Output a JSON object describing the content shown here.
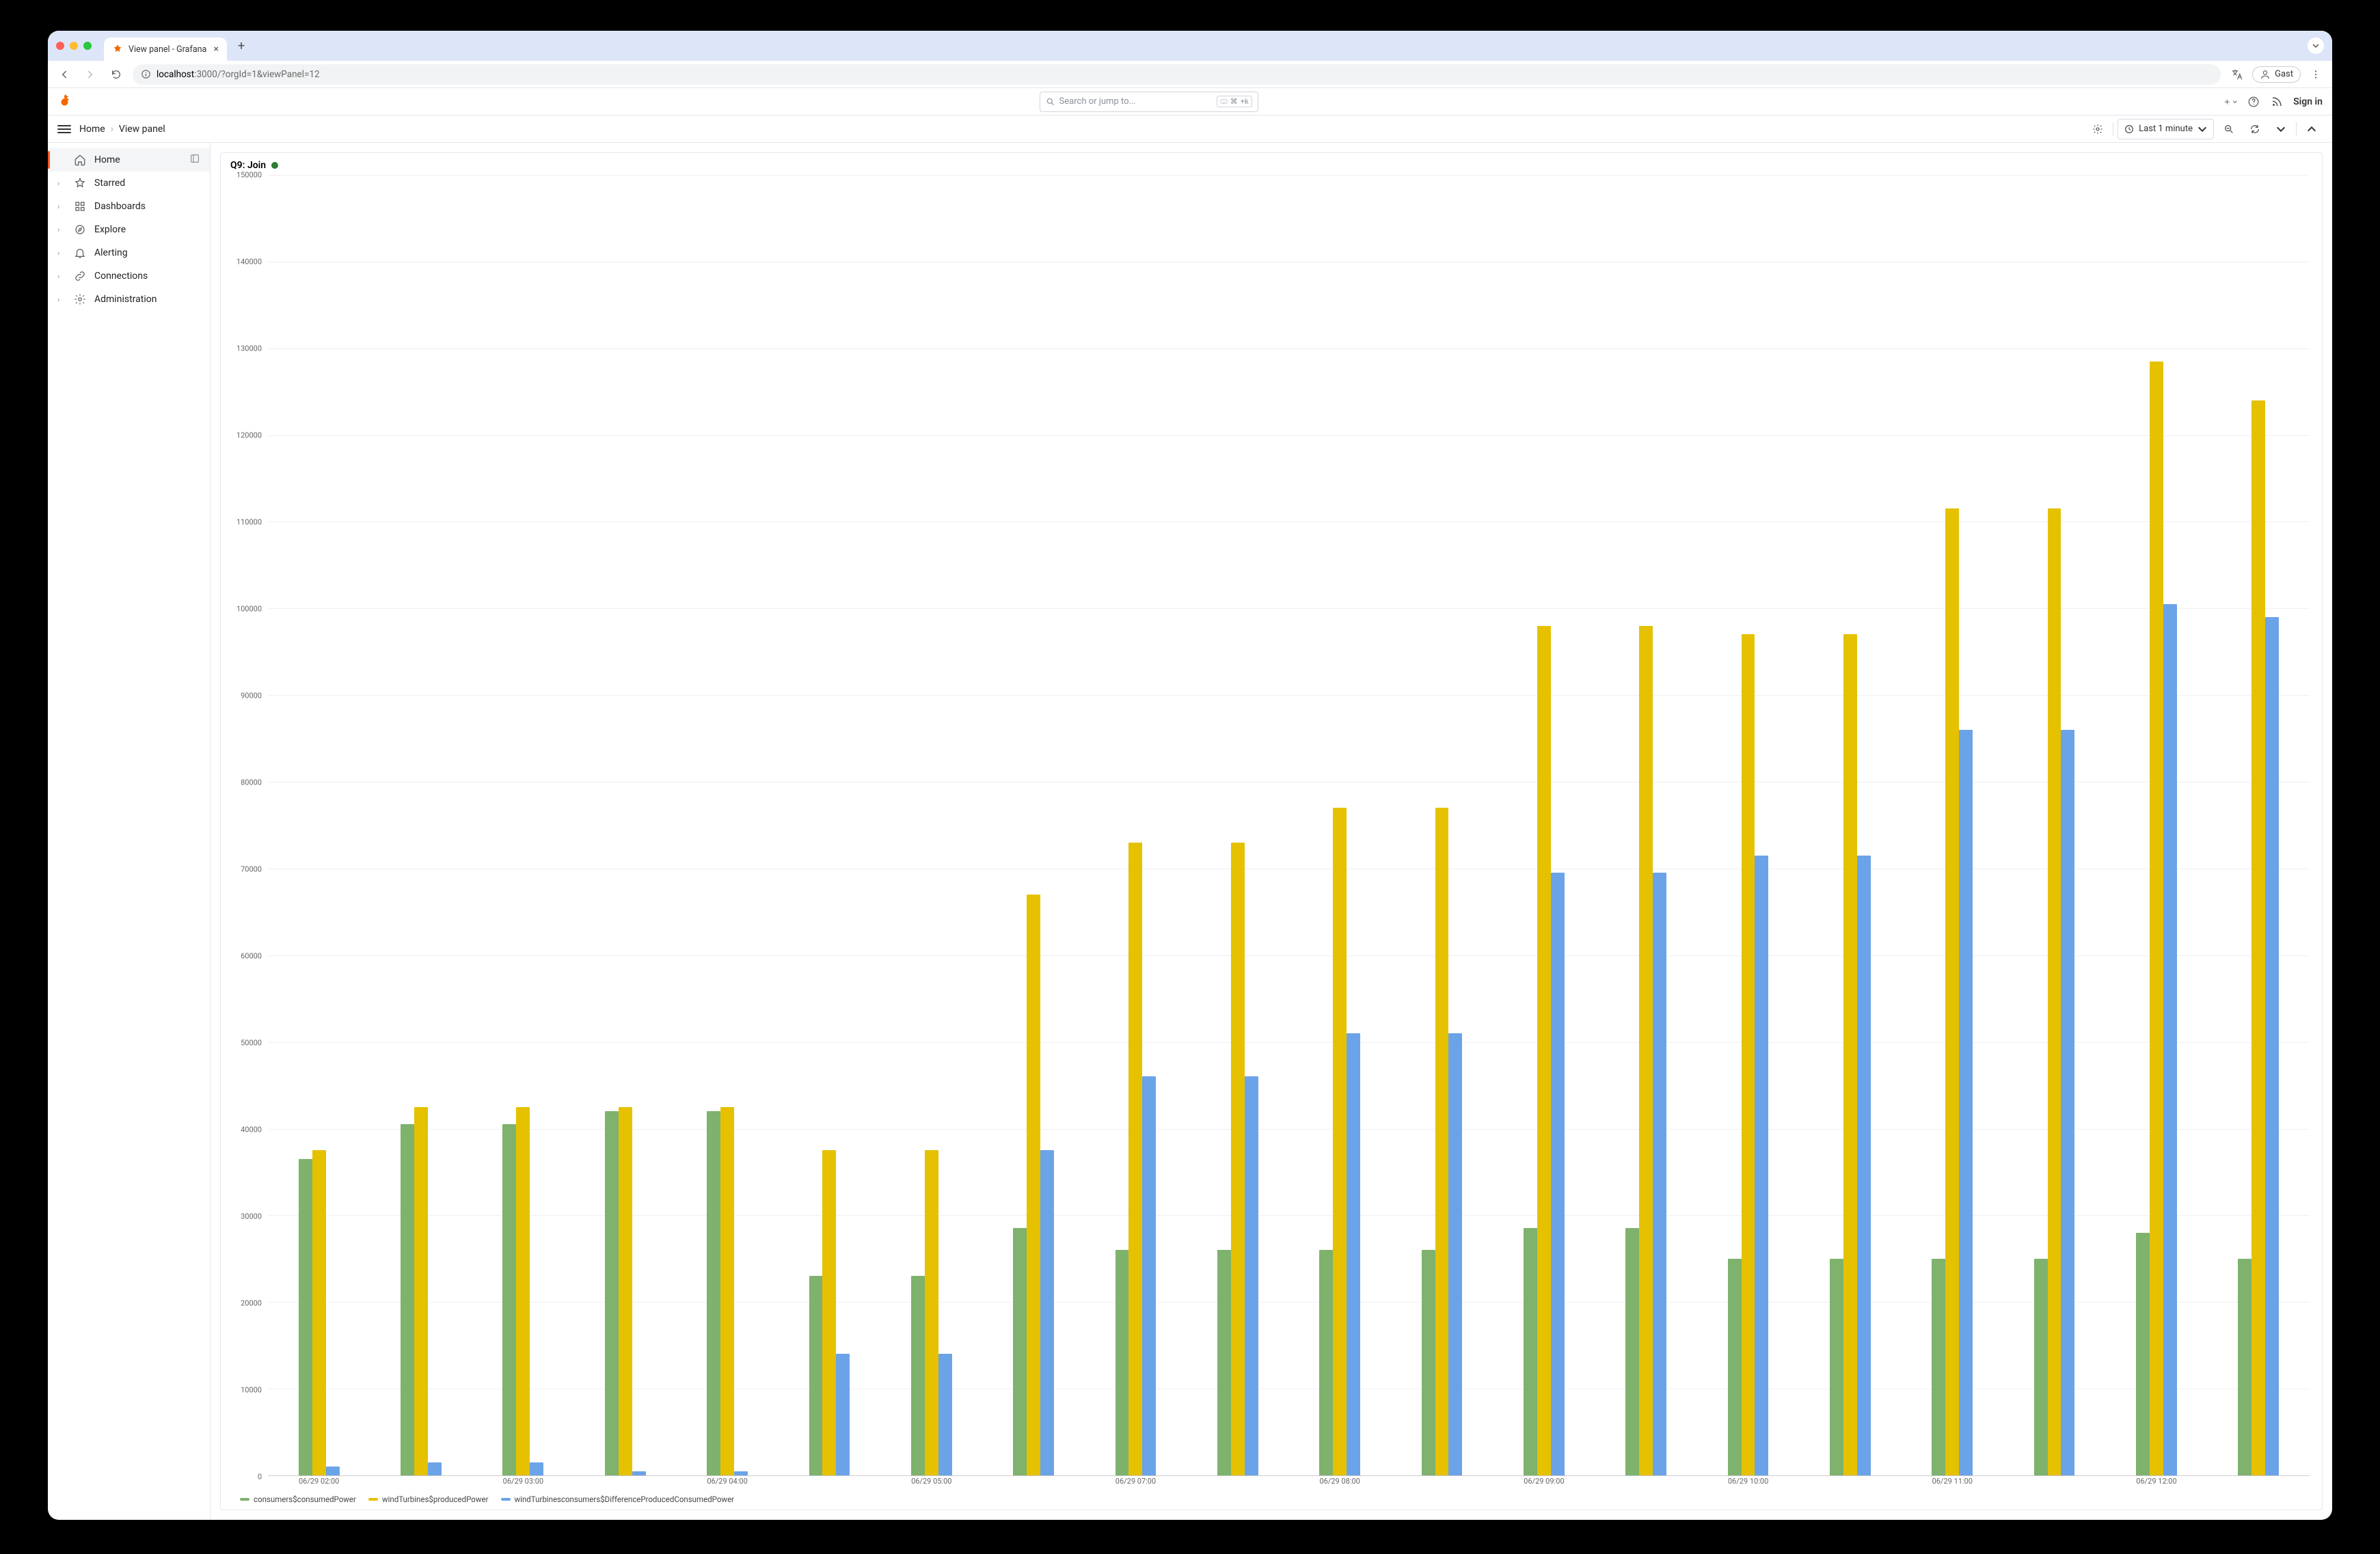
{
  "browser": {
    "tab_title": "View panel - Grafana",
    "url_host": "localhost",
    "url_path": ":3000/?orgId=1&viewPanel=12",
    "guest_label": "Gast"
  },
  "grafana": {
    "search_placeholder": "Search or jump to...",
    "search_kbd1": "⌘",
    "search_kbd2": "+k",
    "signin_label": "Sign in"
  },
  "subheader": {
    "breadcrumb": [
      "Home",
      "View panel"
    ],
    "time_range": "Last 1 minute"
  },
  "sidebar": {
    "items": [
      {
        "label": "Home",
        "icon": "home",
        "hasChevron": false,
        "active": true,
        "dock": true
      },
      {
        "label": "Starred",
        "icon": "star",
        "hasChevron": true
      },
      {
        "label": "Dashboards",
        "icon": "dashboards",
        "hasChevron": true
      },
      {
        "label": "Explore",
        "icon": "compass",
        "hasChevron": true
      },
      {
        "label": "Alerting",
        "icon": "bell",
        "hasChevron": true
      },
      {
        "label": "Connections",
        "icon": "link",
        "hasChevron": true
      },
      {
        "label": "Administration",
        "icon": "gear",
        "hasChevron": true
      }
    ]
  },
  "panel": {
    "title": "Q9: Join"
  },
  "chart_data": {
    "type": "bar",
    "title": "Q9: Join",
    "ylabel": "",
    "xlabel": "",
    "ylim": [
      0,
      150000
    ],
    "y_ticks": [
      0,
      10000,
      20000,
      30000,
      40000,
      50000,
      60000,
      70000,
      80000,
      90000,
      100000,
      110000,
      120000,
      130000,
      140000,
      150000
    ],
    "x_ticks": [
      {
        "pos": 0.5,
        "label": "06/29 02:00"
      },
      {
        "pos": 2.5,
        "label": "06/29 03:00"
      },
      {
        "pos": 4.5,
        "label": "06/29 04:00"
      },
      {
        "pos": 6.5,
        "label": "06/29 05:00"
      },
      {
        "pos": 8.5,
        "label": "06/29 07:00"
      },
      {
        "pos": 10.5,
        "label": "06/29 08:00"
      },
      {
        "pos": 12.5,
        "label": "06/29 09:00"
      },
      {
        "pos": 14.5,
        "label": "06/29 10:00"
      },
      {
        "pos": 16.5,
        "label": "06/29 11:00"
      },
      {
        "pos": 18.5,
        "label": "06/29 12:00"
      }
    ],
    "n_groups": 20,
    "series": [
      {
        "name": "consumers$consumedPower",
        "color": "#7eb26d",
        "values": [
          36500,
          40500,
          40500,
          42000,
          42000,
          23000,
          23000,
          28500,
          26000,
          26000,
          26000,
          26000,
          28500,
          28500,
          25000,
          25000,
          25000,
          25000,
          28000,
          25000
        ]
      },
      {
        "name": "windTurbines$producedPower",
        "color": "#e5c100",
        "values": [
          37500,
          42500,
          42500,
          42500,
          42500,
          37500,
          37500,
          67000,
          73000,
          73000,
          77000,
          77000,
          98000,
          98000,
          97000,
          97000,
          111500,
          111500,
          128500,
          124000
        ]
      },
      {
        "name": "windTurbinesconsumers$DifferenceProducedConsumedPower",
        "color": "#6ba3e8",
        "values": [
          1000,
          1500,
          1500,
          500,
          500,
          14000,
          14000,
          37500,
          46000,
          46000,
          51000,
          51000,
          69500,
          69500,
          71500,
          71500,
          86000,
          86000,
          100500,
          99000
        ]
      }
    ]
  }
}
